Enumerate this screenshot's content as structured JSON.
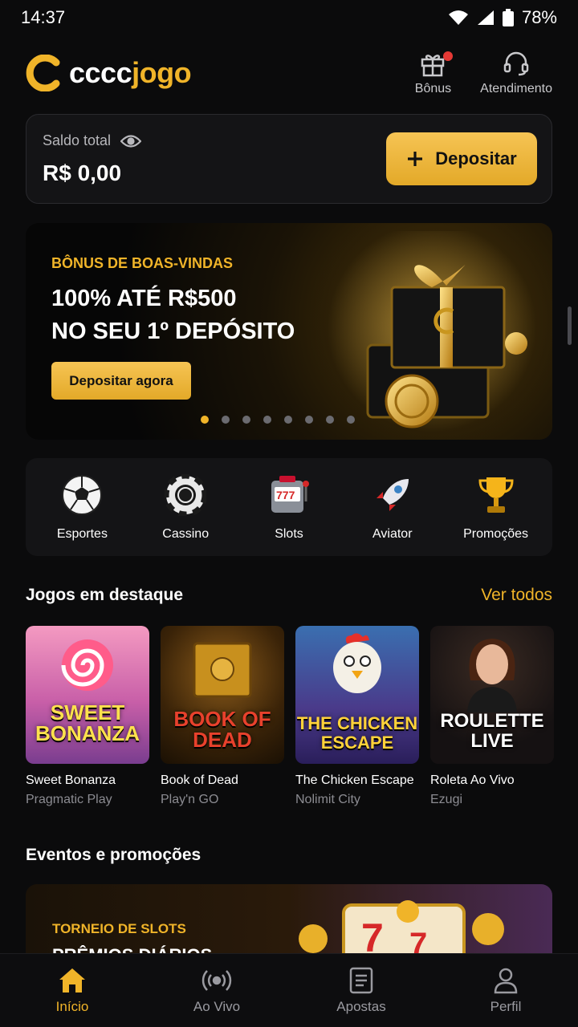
{
  "status_bar": {
    "time": "14:37",
    "battery": "78%"
  },
  "header": {
    "logo_white": "cccc",
    "logo_gold": "jogo",
    "actions": [
      {
        "label": "Bônus",
        "icon": "gift-icon",
        "has_badge": true
      },
      {
        "label": "Atendimento",
        "icon": "headset-icon"
      }
    ]
  },
  "balance": {
    "label": "Saldo total",
    "value": "R$ 0,00",
    "deposit_label": "Depositar"
  },
  "banner": {
    "kicker": "BÔNUS DE BOAS-VINDAS",
    "title_line1": "100% ATÉ R$500",
    "title_line2": "NO SEU 1º DEPÓSITO",
    "button": "Depositar agora",
    "slides": 8,
    "active_slide": 1
  },
  "categories": [
    {
      "label": "Esportes",
      "icon": "soccer-ball-icon"
    },
    {
      "label": "Cassino",
      "icon": "poker-chip-icon"
    },
    {
      "label": "Slots",
      "icon": "slot-machine-icon"
    },
    {
      "label": "Aviator",
      "icon": "rocket-icon"
    },
    {
      "label": "Promoções",
      "icon": "trophy-icon"
    }
  ],
  "featured": {
    "title": "Jogos em destaque",
    "see_all": "Ver todos",
    "games": [
      {
        "name": "Sweet Bonanza",
        "provider": "Pragmatic Play",
        "art_line1": "SWEET",
        "art_line2": "BONANZA"
      },
      {
        "name": "Book of Dead",
        "provider": "Play'n GO",
        "art_line1": "BOOK OF",
        "art_line2": "DEAD"
      },
      {
        "name": "The Chicken Escape",
        "provider": "Nolimit City",
        "art_line1": "THE CHICKEN",
        "art_line2": "ESCAPE"
      },
      {
        "name": "Roleta Ao Vivo",
        "provider": "Ezugi",
        "art_line1": "ROULETTE",
        "art_line2": "LIVE"
      }
    ]
  },
  "events": {
    "title": "Eventos e promoções",
    "card_kicker": "TORNEIO DE SLOTS",
    "card_title": "PRÊMIOS DIÁRIOS"
  },
  "bottom_nav": [
    {
      "label": "Início",
      "icon": "home-icon",
      "active": true
    },
    {
      "label": "Ao Vivo",
      "icon": "live-broadcast-icon"
    },
    {
      "label": "Apostas",
      "icon": "bets-slip-icon"
    },
    {
      "label": "Perfil",
      "icon": "user-icon"
    }
  ],
  "colors": {
    "accent": "#f0b429",
    "background": "#0b0b0c",
    "card": "#141416"
  }
}
